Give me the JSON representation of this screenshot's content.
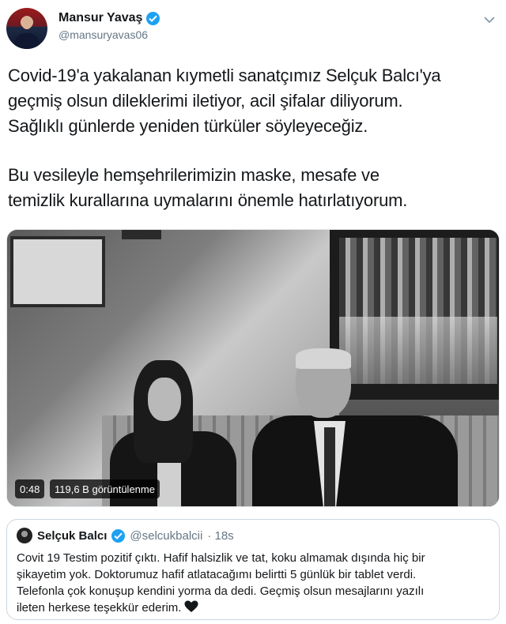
{
  "author": {
    "display_name": "Mansur Yavaş",
    "handle": "@mansuryavas06"
  },
  "tweet": {
    "lines": [
      "Covid-19'a yakalanan kıymetli sanatçımız Selçuk Balcı'ya",
      "geçmiş olsun dileklerimi iletiyor, acil şifalar diliyorum.",
      "Sağlıklı günlerde yeniden türküler söyleyeceğiz.",
      "Bu vesileyle hemşehrilerimizin maske, mesafe ve",
      "temizlik kurallarına uymalarını önemle hatırlatıyorum."
    ]
  },
  "video": {
    "duration": "0:48",
    "views": "119,6 B görüntülenme"
  },
  "quoted": {
    "display_name": "Selçuk Balcı",
    "handle": "@selcukbalcii",
    "time": "· 18s",
    "lines": [
      "Covit 19 Testim pozitif çıktı. Hafif halsizlik ve tat, koku almamak dışında hiç bir",
      "şikayetim yok. Doktorumuz hafif atlatacağımı belirtti 5 günlük bir tablet verdi.",
      "Telefonla çok konuşup kendini yorma da dedi. Geçmiş olsun mesajlarını yazılı",
      "ileten herkese teşekkür ederim."
    ]
  },
  "icons": {
    "verified": "verified-badge-icon",
    "caret": "chevron-down-icon",
    "heart": "black-heart-icon"
  },
  "colors": {
    "verified": "#1da1f2",
    "secondary_text": "#657786",
    "border": "#ccd6dd"
  }
}
